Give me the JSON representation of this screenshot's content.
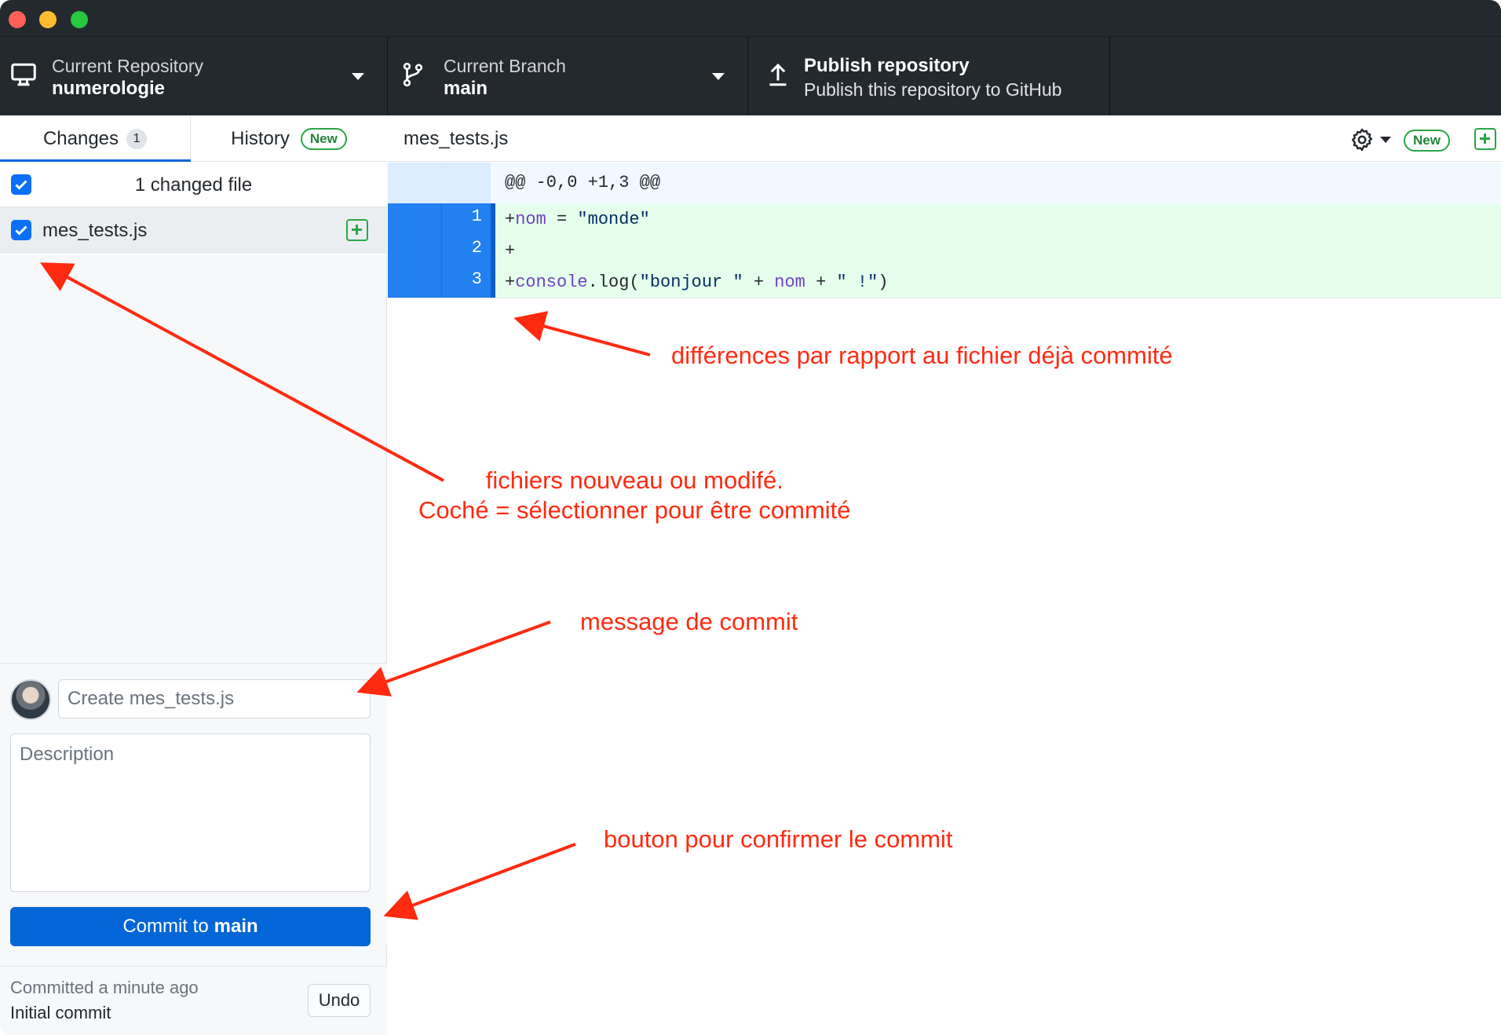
{
  "toolbar": {
    "repository": {
      "title": "Current Repository",
      "value": "numerologie"
    },
    "branch": {
      "title": "Current Branch",
      "value": "main"
    },
    "publish": {
      "title": "Publish repository",
      "subtitle": "Publish this repository to GitHub"
    }
  },
  "sidebar": {
    "tabs": [
      {
        "label": "Changes",
        "badge": "1",
        "selected": true
      },
      {
        "label": "History",
        "badge": "New"
      }
    ],
    "changed_files_label": "1 changed file",
    "files": [
      {
        "name": "mes_tests.js",
        "checked": true,
        "status": "added"
      }
    ],
    "commit": {
      "summary_placeholder": "Create mes_tests.js",
      "description_placeholder": "Description",
      "button_prefix": "Commit to",
      "button_branch": "main"
    },
    "last_commit": {
      "when": "Committed a minute ago",
      "message": "Initial commit",
      "undo_label": "Undo"
    }
  },
  "diff": {
    "file_name": "mes_tests.js",
    "new_badge": "New",
    "hunk_header": "@@ -0,0 +1,3 @@",
    "lines": [
      {
        "number": "1",
        "text": "+nom = \"monde\""
      },
      {
        "number": "2",
        "text": "+"
      },
      {
        "number": "3",
        "text": "+console.log(\"bonjour \" + nom + \" !\")"
      }
    ]
  },
  "annotations": {
    "diff_note": "différences par rapport au fichier déjà commité",
    "files_note_line1": "fichiers nouveau ou modifé.",
    "files_note_line2": "Coché = sélectionner pour être commité",
    "message_note": "message de commit",
    "button_note": "bouton pour confirmer le commit"
  },
  "colors": {
    "annotation": "#ff2a10",
    "accent": "#0366d6",
    "added": "#28a745"
  }
}
